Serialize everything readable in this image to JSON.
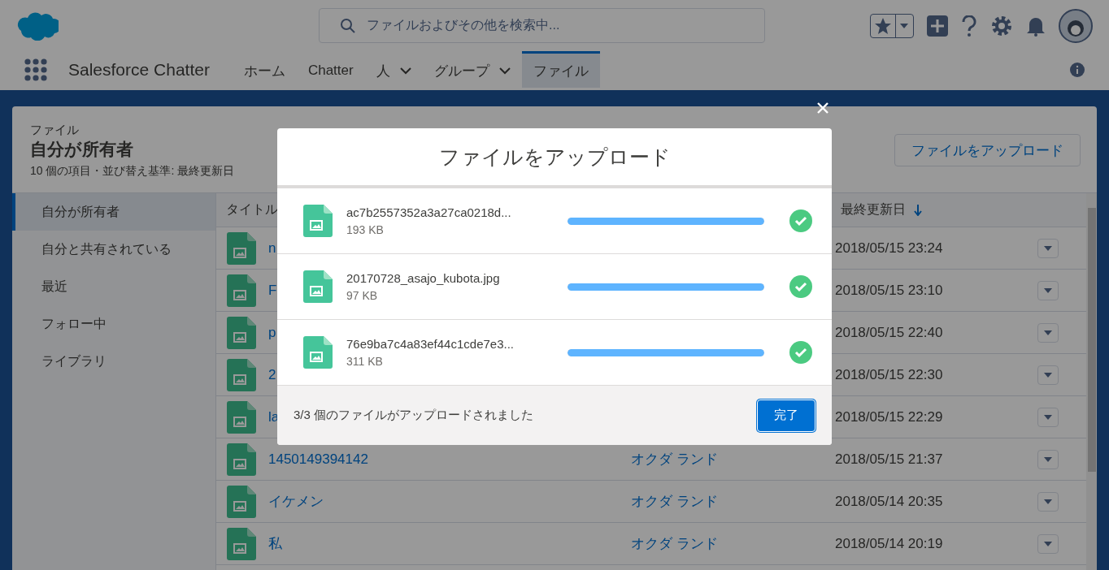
{
  "search": {
    "placeholder": "ファイルおよびその他を検索中..."
  },
  "nav": {
    "app_name": "Salesforce Chatter",
    "tabs": [
      {
        "label": "ホーム",
        "selected": false,
        "has_menu": false
      },
      {
        "label": "Chatter",
        "selected": false,
        "has_menu": false
      },
      {
        "label": "人",
        "selected": false,
        "has_menu": true
      },
      {
        "label": "グループ",
        "selected": false,
        "has_menu": true
      },
      {
        "label": "ファイル",
        "selected": true,
        "has_menu": false
      }
    ]
  },
  "page": {
    "breadcrumb": "ファイル",
    "title": "自分が所有者",
    "summary": "10 個の項目・並び替え基準: 最終更新日",
    "upload_button": "ファイルをアップロード"
  },
  "sidebar": {
    "items": [
      {
        "label": "自分が所有者",
        "selected": true
      },
      {
        "label": "自分と共有されている",
        "selected": false
      },
      {
        "label": "最近",
        "selected": false
      },
      {
        "label": "フォロー中",
        "selected": false
      },
      {
        "label": "ライブラリ",
        "selected": false
      }
    ]
  },
  "table": {
    "columns": [
      {
        "label": "タイトル"
      },
      {
        "label": "最終更新日",
        "sorted_descending": true
      }
    ],
    "rows": [
      {
        "title": "n",
        "date": "2018/05/15 23:24"
      },
      {
        "title": "F",
        "date": "2018/05/15 23:10"
      },
      {
        "title": "p",
        "date": "2018/05/15 22:40"
      },
      {
        "title": "2",
        "date": "2018/05/15 22:30"
      },
      {
        "title": "la",
        "date": "2018/05/15 22:29"
      },
      {
        "title": "1450149394142",
        "owner": "オクダ ランド",
        "date": "2018/05/15 21:37"
      },
      {
        "title": "イケメン",
        "owner": "オクダ ランド",
        "date": "2018/05/14 20:35"
      },
      {
        "title": "私",
        "owner": "オクダ ランド",
        "date": "2018/05/14 20:19"
      }
    ]
  },
  "modal": {
    "title": "ファイルをアップロード",
    "files": [
      {
        "name": "ac7b2557352a3a27ca0218d...",
        "size": "193 KB",
        "level": 1,
        "done": true
      },
      {
        "name": "20170728_asajo_kubota.jpg",
        "size": "97 KB",
        "level": 1,
        "done": true
      },
      {
        "name": "76e9ba7c4a83ef44c1cde7e3...",
        "size": "311 KB",
        "level": 1,
        "done": true
      }
    ],
    "status": "3/3 個のファイルがアップロードされました",
    "done_button": "完了"
  }
}
